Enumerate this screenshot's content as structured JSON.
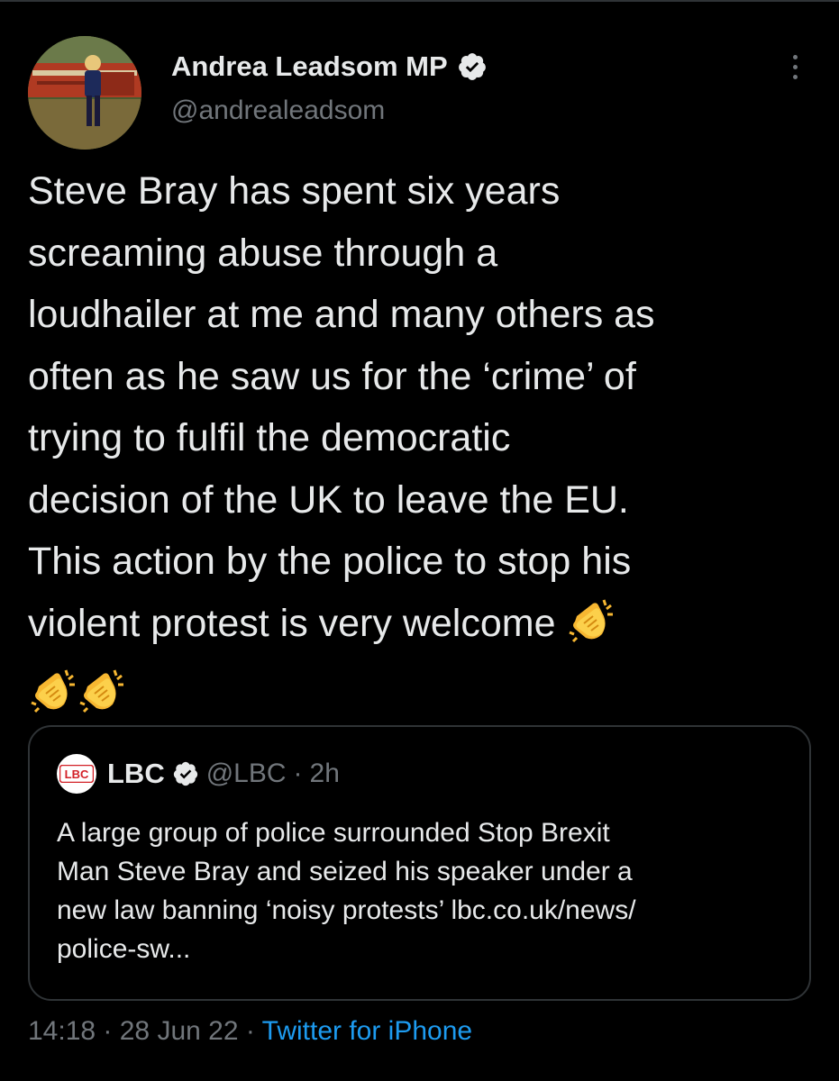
{
  "author": {
    "name": "Andrea Leadsom MP",
    "handle": "@andrealeadsom"
  },
  "tweet": {
    "lines": [
      "Steve Bray has spent six years",
      "screaming abuse through a",
      "loudhailer at me and many others as",
      "often as he saw us for the ‘crime’ of",
      "trying to fulfil the democratic",
      "decision of the UK to leave the EU.",
      "This action by the police to stop his",
      "violent protest is very welcome"
    ],
    "emoji": [
      "clapping-hands",
      "clapping-hands",
      "clapping-hands"
    ]
  },
  "quote": {
    "logo_text": "LBC",
    "name": "LBC",
    "handle": "@LBC",
    "separator": "·",
    "time": "2h",
    "lines": [
      "A large group of police surrounded Stop Brexit",
      "Man Steve Bray and seized his speaker under a",
      "new law banning ‘noisy protests’ lbc.co.uk/news/",
      "police-sw..."
    ]
  },
  "meta": {
    "time": "14:18",
    "sep1": " · ",
    "date": "28 Jun 22",
    "sep2": " · ",
    "source": "Twitter for iPhone"
  },
  "colors": {
    "background": "#000000",
    "text": "#e7e9ea",
    "muted": "#71767b",
    "link": "#1d9bf0",
    "border": "#2f3336",
    "lbc_red": "#d32027"
  },
  "icons": [
    "verified-badge-icon",
    "more-options-icon",
    "clapping-hands-emoji",
    "lbc-logo"
  ]
}
